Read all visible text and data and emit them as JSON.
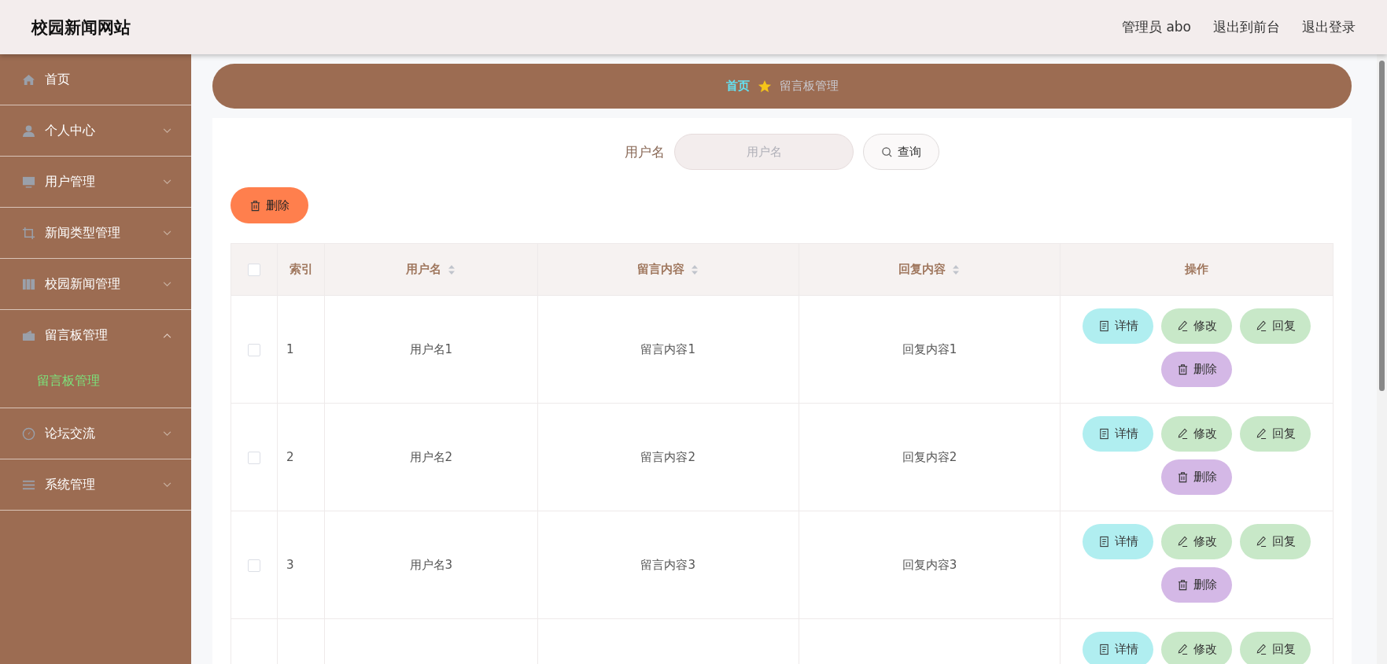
{
  "header": {
    "title": "校园新闻网站",
    "links": [
      "管理员 abo",
      "退出到前台",
      "退出登录"
    ]
  },
  "sidebar": {
    "items": [
      {
        "label": "首页",
        "expandable": false
      },
      {
        "label": "个人中心",
        "expandable": true,
        "expanded": false
      },
      {
        "label": "用户管理",
        "expandable": true,
        "expanded": false
      },
      {
        "label": "新闻类型管理",
        "expandable": true,
        "expanded": false
      },
      {
        "label": "校园新闻管理",
        "expandable": true,
        "expanded": false
      },
      {
        "label": "留言板管理",
        "expandable": true,
        "expanded": true,
        "children": [
          {
            "label": "留言板管理",
            "selected": true
          }
        ]
      },
      {
        "label": "论坛交流",
        "expandable": true,
        "expanded": false
      },
      {
        "label": "系统管理",
        "expandable": true,
        "expanded": false
      }
    ]
  },
  "breadcrumb": [
    "首页",
    "留言板管理"
  ],
  "search": {
    "label": "用户名",
    "placeholder": "用户名",
    "button": "查询"
  },
  "bulk_delete": "删除",
  "table": {
    "select_all_checked": false,
    "columns": [
      {
        "label": "索引",
        "sortable": false
      },
      {
        "label": "用户名",
        "sortable": true
      },
      {
        "label": "留言内容",
        "sortable": true
      },
      {
        "label": "回复内容",
        "sortable": true
      },
      {
        "label": "操作",
        "sortable": false
      }
    ],
    "rows": [
      {
        "checked": false,
        "cells": [
          "1",
          "用户名1",
          "留言内容1",
          "回复内容1"
        ],
        "actions": [
          {
            "kind": "detail",
            "label": "详情"
          },
          {
            "kind": "edit",
            "label": "修改"
          },
          {
            "kind": "reply",
            "label": "回复"
          },
          {
            "kind": "delete",
            "label": "删除"
          }
        ]
      },
      {
        "checked": false,
        "cells": [
          "2",
          "用户名2",
          "留言内容2",
          "回复内容2"
        ],
        "actions": [
          {
            "kind": "detail",
            "label": "详情"
          },
          {
            "kind": "edit",
            "label": "修改"
          },
          {
            "kind": "reply",
            "label": "回复"
          },
          {
            "kind": "delete",
            "label": "删除"
          }
        ]
      },
      {
        "checked": false,
        "cells": [
          "3",
          "用户名3",
          "留言内容3",
          "回复内容3"
        ],
        "actions": [
          {
            "kind": "detail",
            "label": "详情"
          },
          {
            "kind": "edit",
            "label": "修改"
          },
          {
            "kind": "reply",
            "label": "回复"
          },
          {
            "kind": "delete",
            "label": "删除"
          }
        ]
      },
      {
        "cells": [],
        "actions": [
          {
            "kind": "detail",
            "label": "详情"
          },
          {
            "kind": "edit",
            "label": "修改"
          },
          {
            "kind": "reply",
            "label": "回复"
          }
        ]
      }
    ]
  }
}
